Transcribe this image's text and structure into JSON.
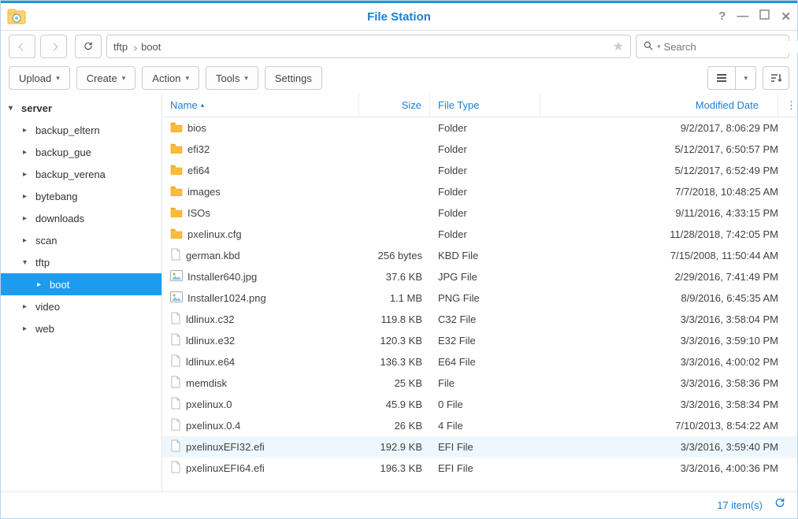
{
  "header": {
    "title": "File Station"
  },
  "nav": {
    "breadcrumb": [
      "tftp",
      "boot"
    ]
  },
  "search": {
    "placeholder": "Search"
  },
  "toolbar": {
    "upload": "Upload",
    "create": "Create",
    "action": "Action",
    "tools": "Tools",
    "settings": "Settings"
  },
  "sidebar": {
    "root": "server",
    "items": [
      {
        "label": "backup_eltern",
        "depth": 1,
        "expandable": true,
        "expanded": false
      },
      {
        "label": "backup_gue",
        "depth": 1,
        "expandable": true,
        "expanded": false
      },
      {
        "label": "backup_verena",
        "depth": 1,
        "expandable": true,
        "expanded": false
      },
      {
        "label": "bytebang",
        "depth": 1,
        "expandable": true,
        "expanded": false
      },
      {
        "label": "downloads",
        "depth": 1,
        "expandable": true,
        "expanded": false
      },
      {
        "label": "scan",
        "depth": 1,
        "expandable": true,
        "expanded": false
      },
      {
        "label": "tftp",
        "depth": 1,
        "expandable": true,
        "expanded": true
      },
      {
        "label": "boot",
        "depth": 2,
        "expandable": true,
        "expanded": false,
        "selected": true
      },
      {
        "label": "video",
        "depth": 1,
        "expandable": true,
        "expanded": false
      },
      {
        "label": "web",
        "depth": 1,
        "expandable": true,
        "expanded": false
      }
    ]
  },
  "columns": {
    "name": "Name",
    "size": "Size",
    "type": "File Type",
    "date": "Modified Date"
  },
  "files": [
    {
      "name": "bios",
      "icon": "folder",
      "size": "",
      "type": "Folder",
      "date": "9/2/2017, 8:06:29 PM"
    },
    {
      "name": "efi32",
      "icon": "folder",
      "size": "",
      "type": "Folder",
      "date": "5/12/2017, 6:50:57 PM"
    },
    {
      "name": "efi64",
      "icon": "folder",
      "size": "",
      "type": "Folder",
      "date": "5/12/2017, 6:52:49 PM"
    },
    {
      "name": "images",
      "icon": "folder",
      "size": "",
      "type": "Folder",
      "date": "7/7/2018, 10:48:25 AM"
    },
    {
      "name": "ISOs",
      "icon": "folder",
      "size": "",
      "type": "Folder",
      "date": "9/11/2016, 4:33:15 PM"
    },
    {
      "name": "pxelinux.cfg",
      "icon": "folder",
      "size": "",
      "type": "Folder",
      "date": "11/28/2018, 7:42:05 PM"
    },
    {
      "name": "german.kbd",
      "icon": "file",
      "size": "256 bytes",
      "type": "KBD File",
      "date": "7/15/2008, 11:50:44 AM"
    },
    {
      "name": "Installer640.jpg",
      "icon": "image",
      "size": "37.6 KB",
      "type": "JPG File",
      "date": "2/29/2016, 7:41:49 PM"
    },
    {
      "name": "Installer1024.png",
      "icon": "image",
      "size": "1.1 MB",
      "type": "PNG File",
      "date": "8/9/2016, 6:45:35 AM"
    },
    {
      "name": "ldlinux.c32",
      "icon": "file",
      "size": "119.8 KB",
      "type": "C32 File",
      "date": "3/3/2016, 3:58:04 PM"
    },
    {
      "name": "ldlinux.e32",
      "icon": "file",
      "size": "120.3 KB",
      "type": "E32 File",
      "date": "3/3/2016, 3:59:10 PM"
    },
    {
      "name": "ldlinux.e64",
      "icon": "file",
      "size": "136.3 KB",
      "type": "E64 File",
      "date": "3/3/2016, 4:00:02 PM"
    },
    {
      "name": "memdisk",
      "icon": "file",
      "size": "25 KB",
      "type": "File",
      "date": "3/3/2016, 3:58:36 PM"
    },
    {
      "name": "pxelinux.0",
      "icon": "file",
      "size": "45.9 KB",
      "type": "0 File",
      "date": "3/3/2016, 3:58:34 PM"
    },
    {
      "name": "pxelinux.0.4",
      "icon": "file",
      "size": "26 KB",
      "type": "4 File",
      "date": "7/10/2013, 8:54:22 AM"
    },
    {
      "name": "pxelinuxEFI32.efi",
      "icon": "file",
      "size": "192.9 KB",
      "type": "EFI File",
      "date": "3/3/2016, 3:59:40 PM",
      "highlight": true
    },
    {
      "name": "pxelinuxEFI64.efi",
      "icon": "file",
      "size": "196.3 KB",
      "type": "EFI File",
      "date": "3/3/2016, 4:00:36 PM"
    }
  ],
  "footer": {
    "count": "17 item(s)"
  }
}
